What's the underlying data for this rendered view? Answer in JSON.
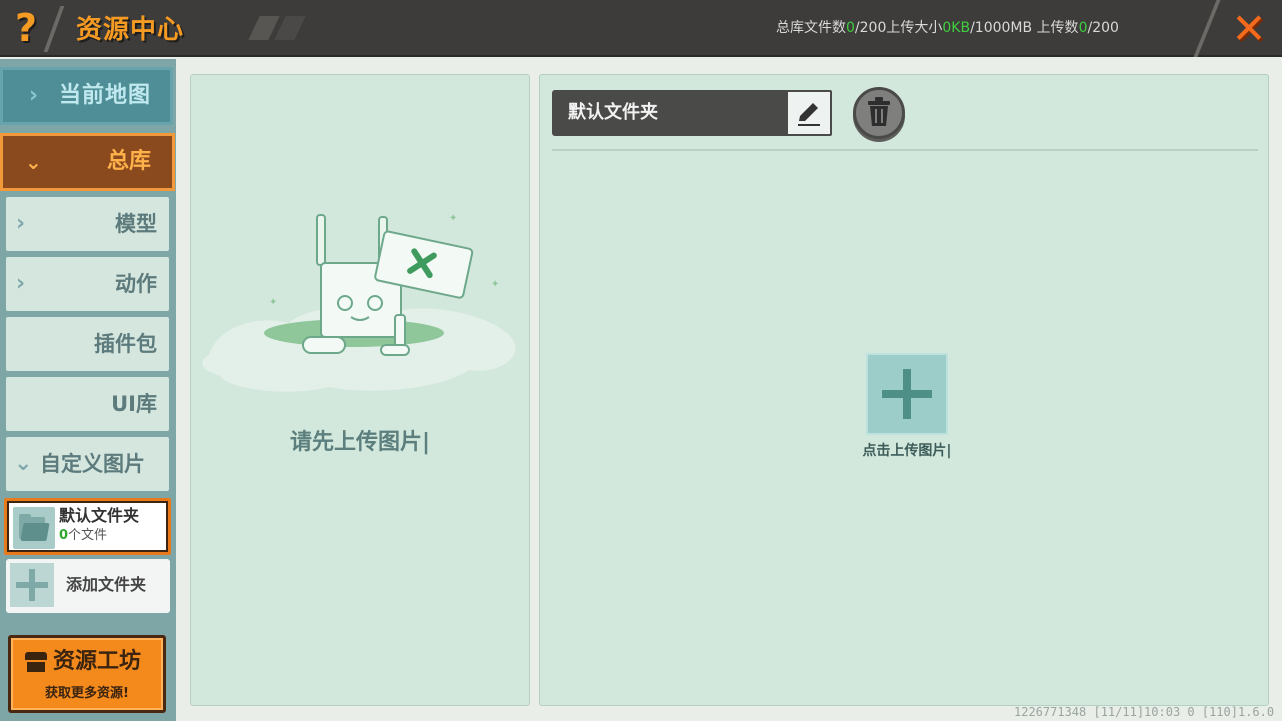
{
  "header": {
    "title": "资源中心",
    "stats": {
      "total_label": "总库文件数",
      "total_count": "0",
      "total_max": "/200",
      "size_label": "上传大小",
      "size_value": "0KB",
      "size_max": "/1000MB",
      "upload_label": " 上传数",
      "upload_count": "0",
      "upload_max": "/200"
    }
  },
  "sidebar": {
    "current_map": "当前地图",
    "library": "总库",
    "items": [
      {
        "label": "模型"
      },
      {
        "label": "动作"
      },
      {
        "label": "插件包"
      },
      {
        "label": "UI库"
      },
      {
        "label": "自定义图片"
      }
    ],
    "folder": {
      "name": "默认文件夹",
      "count": "0",
      "count_suffix": "个文件"
    },
    "add_folder": "添加文件夹",
    "workshop": {
      "title": "资源工坊",
      "subtitle": "获取更多资源!"
    }
  },
  "left_panel": {
    "empty_text": "请先上传图片|"
  },
  "right_panel": {
    "folder_title": "默认文件夹",
    "upload_label": "点击上传图片|"
  },
  "footer": {
    "info": "1226771348   [11/11]10:03 0   [110]1.6.0"
  },
  "colors": {
    "accent_orange": "#f59a23",
    "panel_bg": "#d3e8dd",
    "sidebar_bg": "#7fa6a7",
    "highlight_green": "#3fcf3f"
  }
}
